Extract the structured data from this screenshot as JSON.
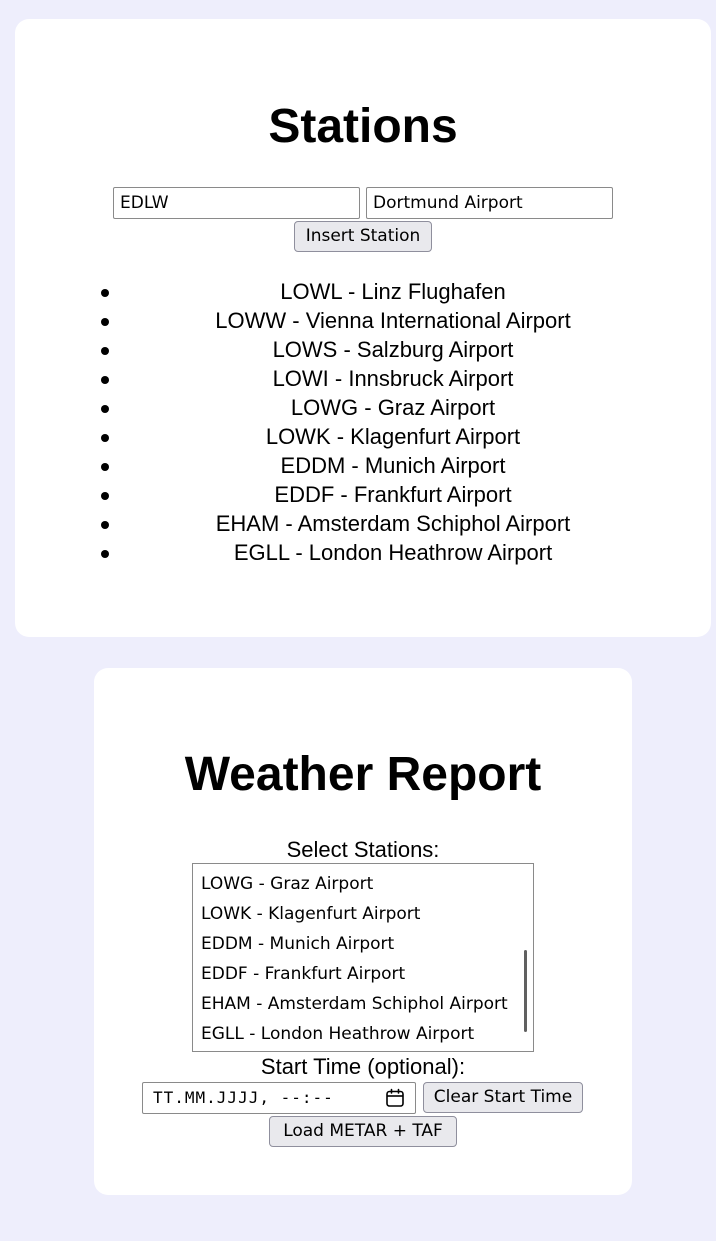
{
  "stations_panel": {
    "title": "Stations",
    "code_input_value": "EDLW",
    "name_input_value": "Dortmund Airport",
    "insert_button_label": "Insert Station",
    "stations": [
      "LOWL - Linz Flughafen",
      "LOWW - Vienna International Airport",
      "LOWS - Salzburg Airport",
      "LOWI - Innsbruck Airport",
      "LOWG - Graz Airport",
      "LOWK - Klagenfurt Airport",
      "EDDM - Munich Airport",
      "EDDF - Frankfurt Airport",
      "EHAM - Amsterdam Schiphol Airport",
      "EGLL - London Heathrow Airport"
    ]
  },
  "weather_panel": {
    "title": "Weather Report",
    "select_label": "Select Stations:",
    "visible_options": [
      "LOWG - Graz Airport",
      "LOWK - Klagenfurt Airport",
      "EDDM - Munich Airport",
      "EDDF - Frankfurt Airport",
      "EHAM - Amsterdam Schiphol Airport",
      "EGLL - London Heathrow Airport"
    ],
    "start_time_label": "Start Time (optional):",
    "start_time_placeholder": "TT.MM.JJJJ, --:--",
    "clear_button_label": "Clear Start Time",
    "load_button_label": "Load METAR + TAF"
  },
  "icons": {
    "calendar": "calendar-icon",
    "bullet": "bullet-icon"
  },
  "colors": {
    "page_background": "#eeeefc",
    "card_background": "#ffffff",
    "button_background": "#e9e9ed"
  }
}
